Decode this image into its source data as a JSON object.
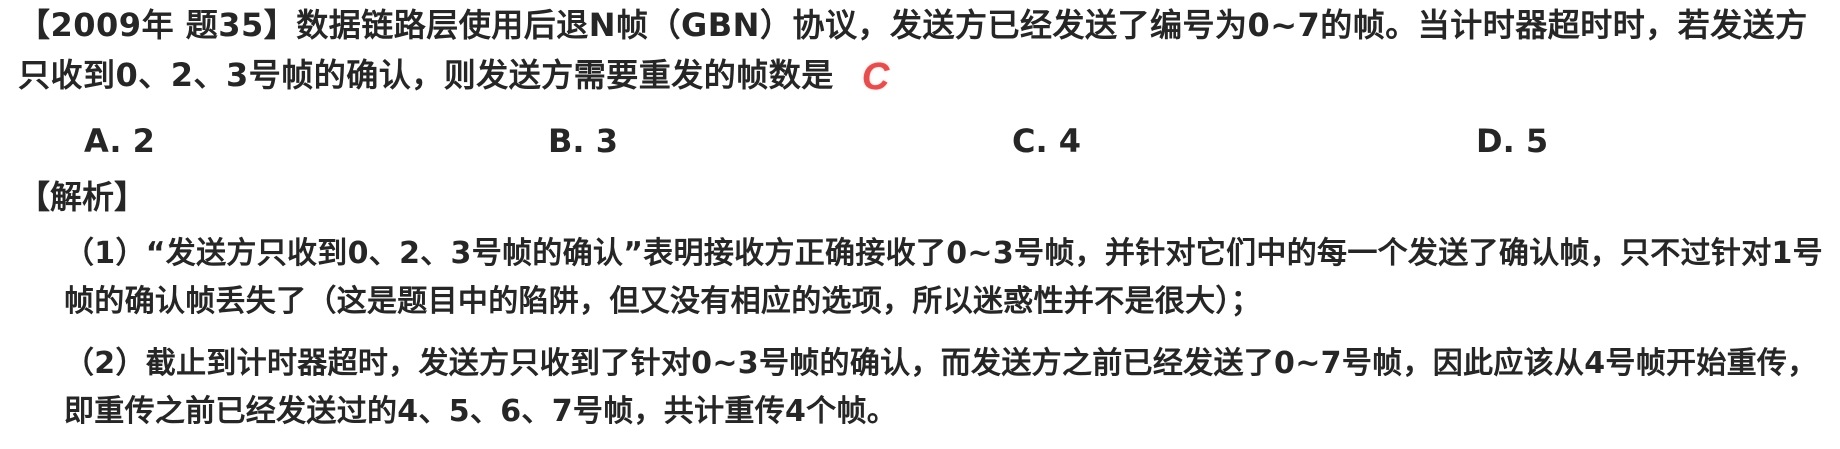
{
  "question": {
    "text": "【2009年 题35】数据链路层使用后退N帧（GBN）协议，发送方已经发送了编号为0~7的帧。当计时器超时时，若发送方只收到0、2、3号帧的确认，则发送方需要重发的帧数是",
    "answer": "C"
  },
  "options": [
    {
      "label": "A. 2"
    },
    {
      "label": "B. 3"
    },
    {
      "label": "C. 4"
    },
    {
      "label": "D. 5"
    }
  ],
  "analysis": {
    "title": "【解析】",
    "paragraphs": [
      "（1）“发送方只收到0、2、3号帧的确认”表明接收方正确接收了0~3号帧，并针对它们中的每一个发送了确认帧，只不过针对1号帧的确认帧丢失了（这是题目中的陷阱，但又没有相应的选项，所以迷惑性并不是很大）；",
      "（2）截止到计时器超时，发送方只收到了针对0~3号帧的确认，而发送方之前已经发送了0~7号帧，因此应该从4号帧开始重传，即重传之前已经发送过的4、5、6、7号帧，共计重传4个帧。"
    ]
  },
  "colors": {
    "text": "#262626",
    "answer_mark": "#e05050"
  }
}
